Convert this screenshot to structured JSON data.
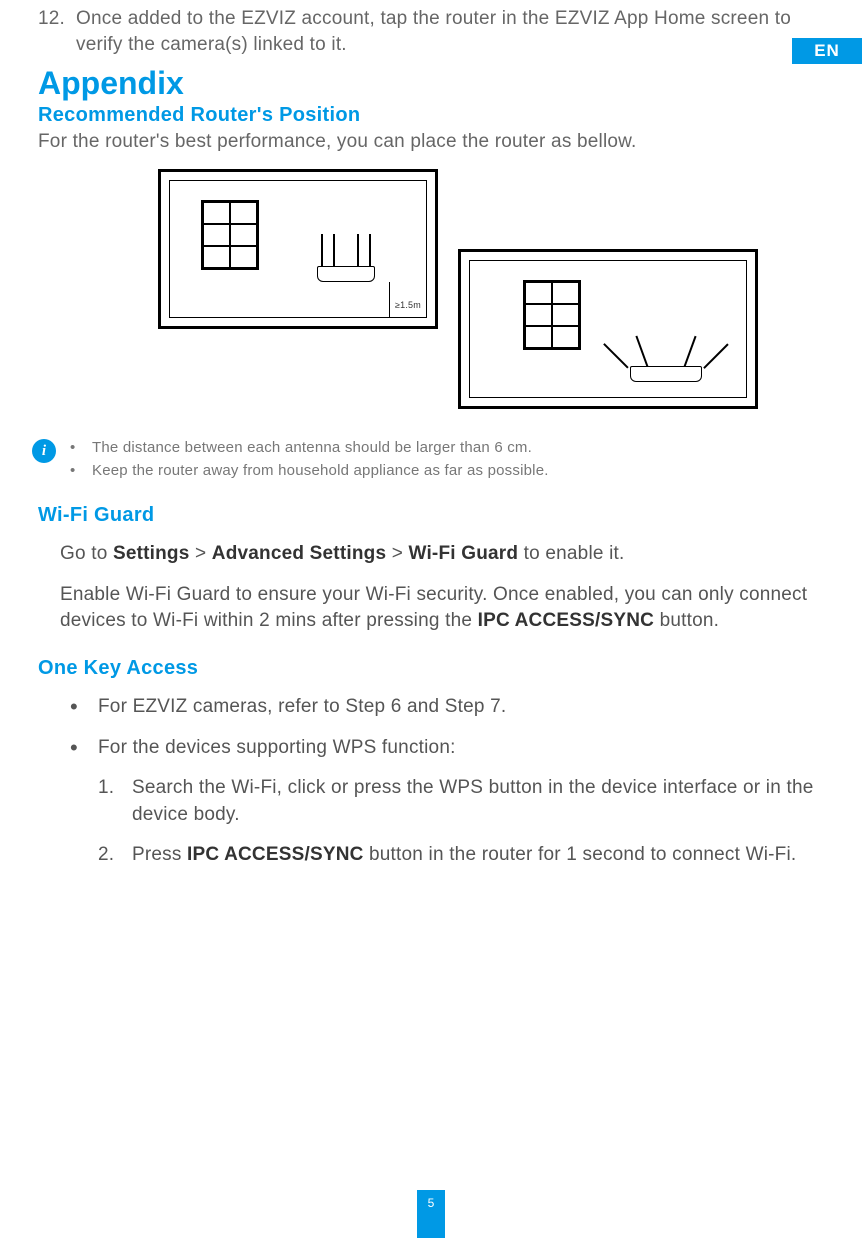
{
  "langTab": "EN",
  "pageNumber": "5",
  "step12": {
    "num": "12.",
    "text": "Once added to the EZVIZ account, tap the router in the EZVIZ App Home screen to verify the camera(s) linked to it."
  },
  "appendixTitle": "Appendix",
  "section1": {
    "title": "Recommended Router's Position",
    "lead": "For the router's best performance, you can place the router as bellow.",
    "heightLabel": "≥1.5m",
    "infoBullets": [
      "The distance between each antenna should be larger than 6 cm.",
      "Keep the router away from household appliance as far as possible."
    ]
  },
  "section2": {
    "title": "Wi-Fi Guard",
    "p1_pre": "Go to ",
    "p1_b1": "Settings",
    "p1_gt1": " > ",
    "p1_b2": "Advanced Settings",
    "p1_gt2": " > ",
    "p1_b3": "Wi-Fi Guard",
    "p1_post": " to enable it.",
    "p2_pre": "Enable Wi-Fi Guard to ensure your Wi-Fi security. Once enabled, you can only connect devices to Wi-Fi within 2 mins after pressing the ",
    "p2_b": "IPC ACCESS/SYNC",
    "p2_post": " button."
  },
  "section3": {
    "title": "One Key Access",
    "bullets": [
      "For EZVIZ cameras, refer to Step 6 and Step 7.",
      "For the devices supporting WPS function:"
    ],
    "ol": [
      {
        "num": "1.",
        "text": "Search the Wi-Fi, click or press the WPS button in the device interface or in the device body."
      },
      {
        "num": "2.",
        "pre": "Press ",
        "b": "IPC ACCESS/SYNC",
        "post": " button in the router for 1 second to connect Wi-Fi."
      }
    ]
  }
}
